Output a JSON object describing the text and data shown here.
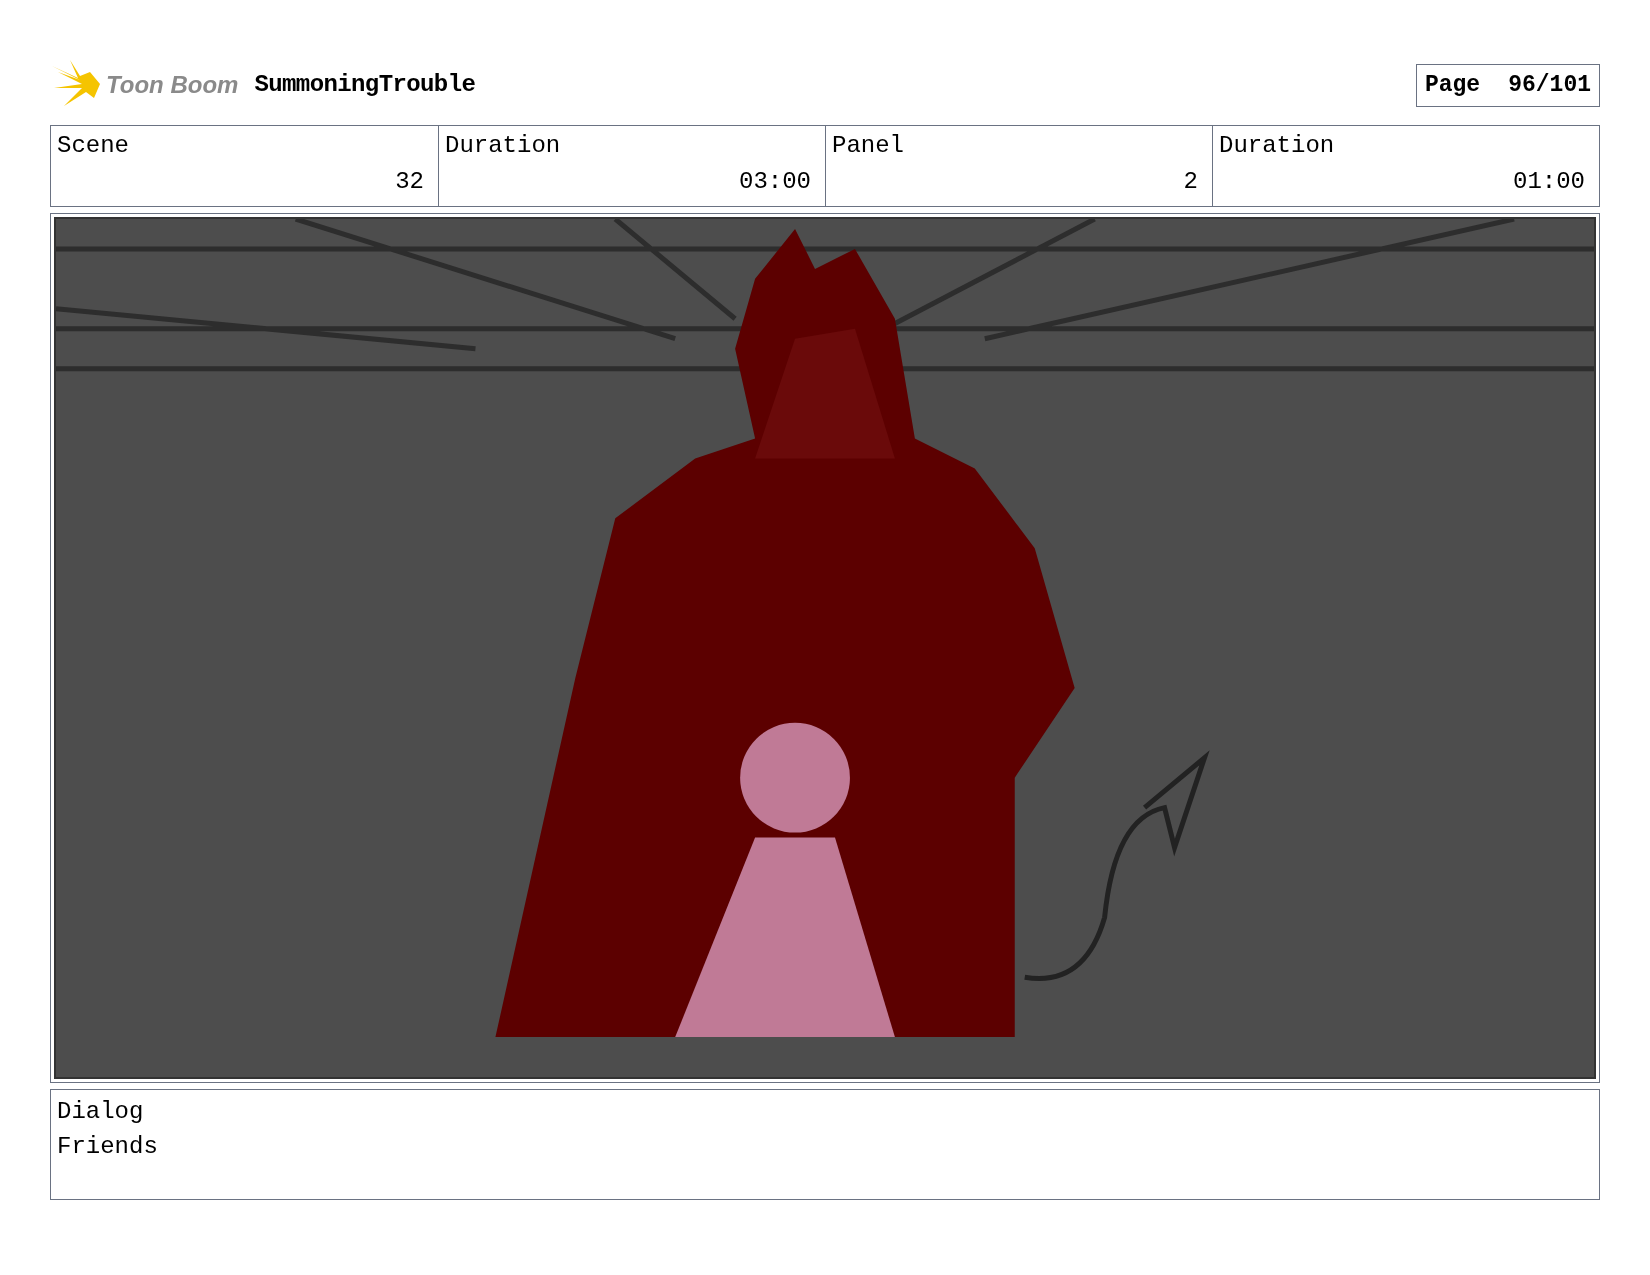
{
  "header": {
    "logo_text": "Toon Boom",
    "project": "SummoningTrouble",
    "page_label": "Page",
    "page_number": "96/101"
  },
  "info": [
    {
      "label": "Scene",
      "value": "32"
    },
    {
      "label": "Duration",
      "value": "03:00"
    },
    {
      "label": "Panel",
      "value": "2"
    },
    {
      "label": "Duration",
      "value": "01:00"
    }
  ],
  "dialog": {
    "label": "Dialog",
    "text": "Friends"
  }
}
